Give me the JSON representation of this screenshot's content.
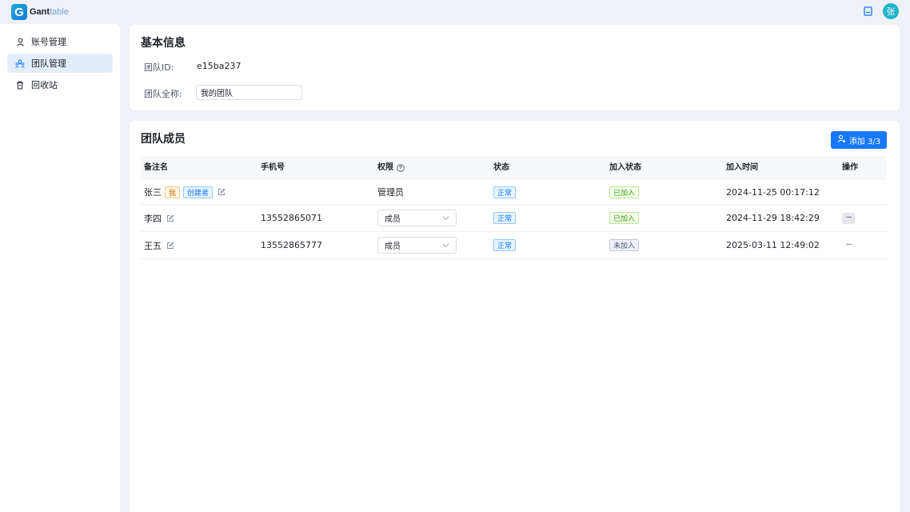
{
  "app": {
    "logo_mark": "G",
    "logo_name_bold": "Gant",
    "logo_name_light": "table",
    "user_avatar": "张"
  },
  "sidebar": {
    "items": [
      {
        "label": "账号管理",
        "icon": "user-icon"
      },
      {
        "label": "团队管理",
        "icon": "team-icon",
        "active": true
      },
      {
        "label": "回收站",
        "icon": "trash-icon"
      }
    ]
  },
  "basic": {
    "title": "基本信息",
    "team_id_label": "团队ID:",
    "team_id_value": "e15ba237",
    "team_name_label": "团队全称:",
    "team_name_value": "我的团队"
  },
  "members": {
    "title": "团队成员",
    "add_button": "添加 3/3",
    "columns": [
      "备注名",
      "手机号",
      "权限",
      "状态",
      "加入状态",
      "加入时间",
      "操作"
    ],
    "rows": [
      {
        "name": "张三",
        "tag_me": "我",
        "tag_creator": "创建者",
        "phone": "",
        "role": "管理员",
        "status": "正常",
        "join_status": "已加入",
        "join_time": "2024-11-25 00:17:12",
        "action": ""
      },
      {
        "name": "李四",
        "phone": "13552865071",
        "role": "成员",
        "status": "正常",
        "join_status": "已加入",
        "join_time": "2024-11-29 18:42:29",
        "action": "···"
      },
      {
        "name": "王五",
        "phone": "13552865777",
        "role": "成员",
        "status": "正常",
        "join_status": "未加入",
        "join_time": "2025-03-11 12:49:02",
        "action": "···"
      }
    ]
  },
  "colors": {
    "primary": "#1677ff",
    "background": "#eef1f6",
    "active_nav": "#e3eefb",
    "avatar": "#1fb5c9"
  }
}
